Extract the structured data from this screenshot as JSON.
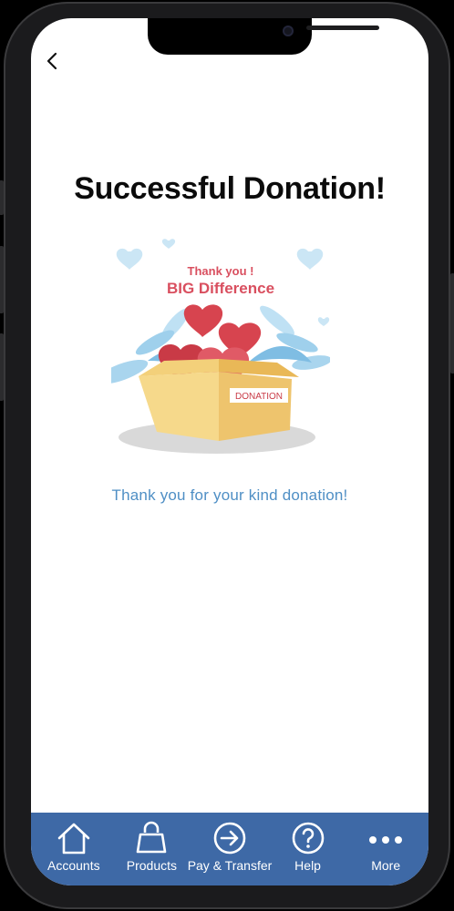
{
  "screen": {
    "title": "Successful Donation!",
    "message": "Thank you for your kind donation!",
    "back_icon": "chevron-left-icon"
  },
  "illustration": {
    "line1": "Thank you !",
    "line2": "BIG Difference",
    "box_label": "DONATION"
  },
  "tabbar": {
    "accent_color": "#3e69a6",
    "items": [
      {
        "label": "Accounts",
        "icon": "home-icon"
      },
      {
        "label": "Products",
        "icon": "shopping-bag-icon"
      },
      {
        "label": "Pay & Transfer",
        "icon": "arrow-circle-icon"
      },
      {
        "label": "Help",
        "icon": "question-circle-icon"
      },
      {
        "label": "More",
        "icon": "more-dots-icon"
      }
    ]
  }
}
